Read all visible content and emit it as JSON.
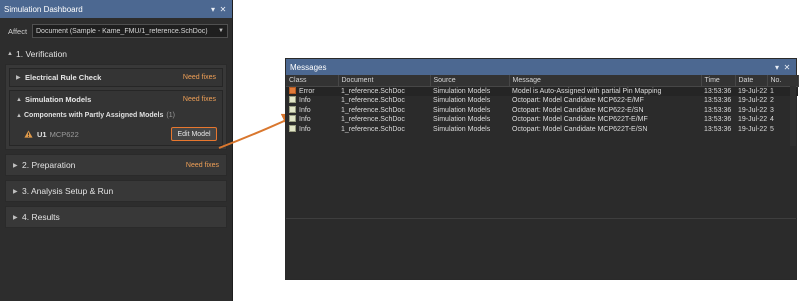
{
  "left_panel": {
    "title": "Simulation Dashboard",
    "pin_icon": "pin-icon",
    "close_icon": "close-icon",
    "affect_label": "Affect",
    "affect_value": "Document (Sample - Kame_FMU/1_reference.SchDoc)",
    "verification": {
      "title": "1. Verification",
      "erc": {
        "label": "Electrical Rule Check",
        "status": "Need fixes"
      },
      "sim_models": {
        "label": "Simulation Models",
        "status": "Need fixes",
        "sub_label": "Components with Partly Assigned Models",
        "sub_count": "(1)",
        "component": {
          "ref": "U1",
          "part": "MCP622",
          "button": "Edit Model"
        }
      }
    },
    "preparation": {
      "title": "2. Preparation",
      "status": "Need fixes"
    },
    "analysis": {
      "title": "3. Analysis Setup & Run"
    },
    "results": {
      "title": "4. Results"
    }
  },
  "messages_panel": {
    "title": "Messages",
    "columns": [
      "Class",
      "Document",
      "Source",
      "Message",
      "Time",
      "Date",
      "No."
    ],
    "rows": [
      {
        "class": "Error",
        "document": "1_reference.SchDoc",
        "source": "Simulation Models",
        "message": "Model is Auto-Assigned with partial Pin Mapping",
        "time": "13:53:36",
        "date": "19-Jul-22",
        "no": "1"
      },
      {
        "class": "Info",
        "document": "1_reference.SchDoc",
        "source": "Simulation Models",
        "message": "Octopart: Model Candidate MCP622-E/MF",
        "time": "13:53:36",
        "date": "19-Jul-22",
        "no": "2"
      },
      {
        "class": "Info",
        "document": "1_reference.SchDoc",
        "source": "Simulation Models",
        "message": "Octopart: Model Candidate MCP622-E/SN",
        "time": "13:53:36",
        "date": "19-Jul-22",
        "no": "3"
      },
      {
        "class": "Info",
        "document": "1_reference.SchDoc",
        "source": "Simulation Models",
        "message": "Octopart: Model Candidate MCP622T-E/MF",
        "time": "13:53:36",
        "date": "19-Jul-22",
        "no": "4"
      },
      {
        "class": "Info",
        "document": "1_reference.SchDoc",
        "source": "Simulation Models",
        "message": "Octopart: Model Candidate MCP622T-E/SN",
        "time": "13:53:36",
        "date": "19-Jul-22",
        "no": "5"
      }
    ]
  },
  "colors": {
    "titlebar": "#4c6891",
    "warning": "#f0a057",
    "highlight": "#e8772e",
    "panel_bg": "#2d2d2d"
  }
}
